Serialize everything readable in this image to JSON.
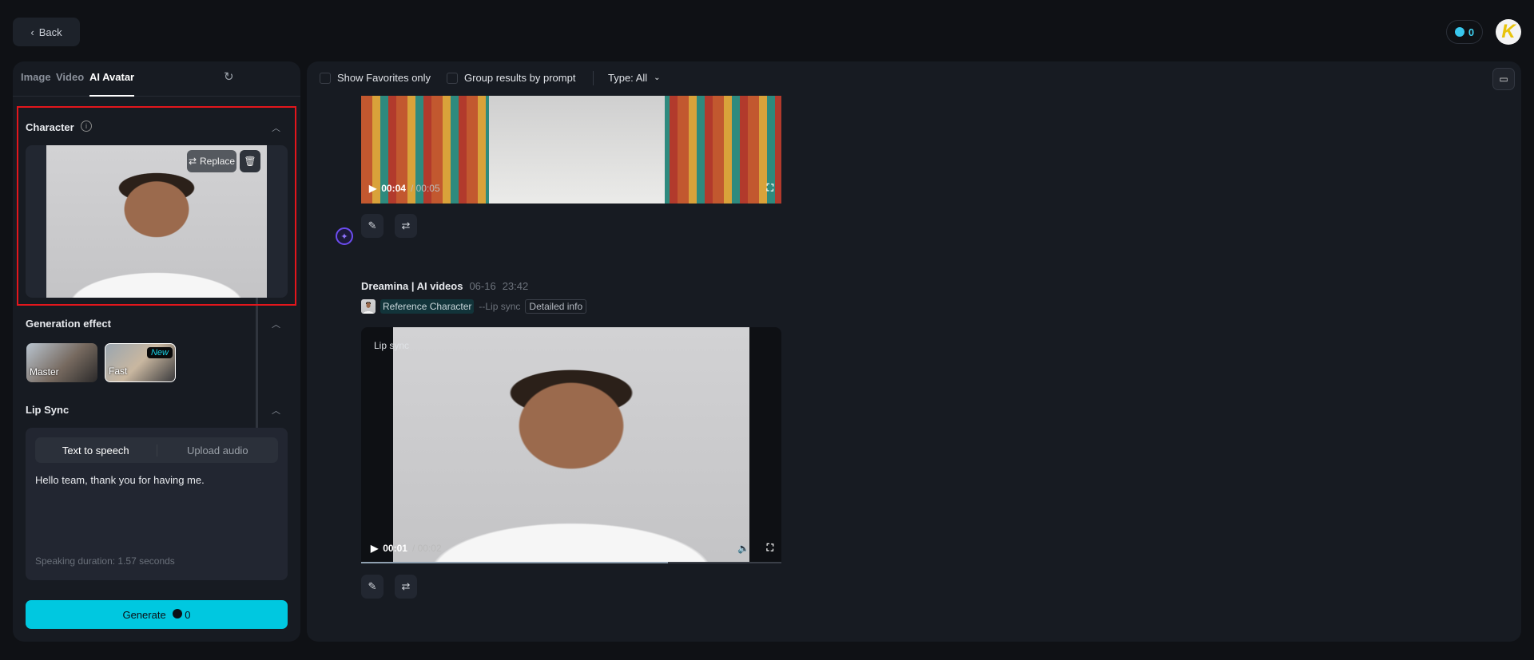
{
  "header": {
    "back_label": "Back",
    "credits": "0",
    "avatar_letter": "K"
  },
  "left_panel": {
    "tabs": [
      {
        "label": "Image"
      },
      {
        "label": "Video"
      },
      {
        "label": "AI Avatar",
        "active": true
      }
    ],
    "character": {
      "title": "Character",
      "replace_label": "Replace"
    },
    "generation_effect": {
      "title": "Generation effect",
      "options": [
        {
          "label": "Master"
        },
        {
          "label": "Fast",
          "badge": "New",
          "selected": true
        }
      ]
    },
    "lip_sync": {
      "title": "Lip Sync",
      "modes": [
        "Text to speech",
        "Upload audio"
      ],
      "active_mode": "Text to speech",
      "text": "Hello team, thank you for having me.",
      "duration": "Speaking duration: 1.57 seconds"
    },
    "generate": {
      "label": "Generate",
      "cost": "0"
    }
  },
  "toolbar": {
    "show_favorites": "Show Favorites only",
    "group_by_prompt": "Group results by prompt",
    "type_filter": "Type: All"
  },
  "results": [
    {
      "video": {
        "current": "00:04",
        "total": "00:05"
      }
    },
    {
      "author": "Dreamina | AI videos",
      "date": "06-16",
      "time": "23:42",
      "reference": "Reference Character",
      "mode": "--Lip sync",
      "details": "Detailed info",
      "overlay_label": "Lip sync",
      "video": {
        "current": "00:01",
        "total": "00:02",
        "progress": 0.73
      }
    }
  ],
  "colors": {
    "accent": "#00c8e0",
    "highlight_border": "#e3161c",
    "brand": "#6c4cf0"
  }
}
